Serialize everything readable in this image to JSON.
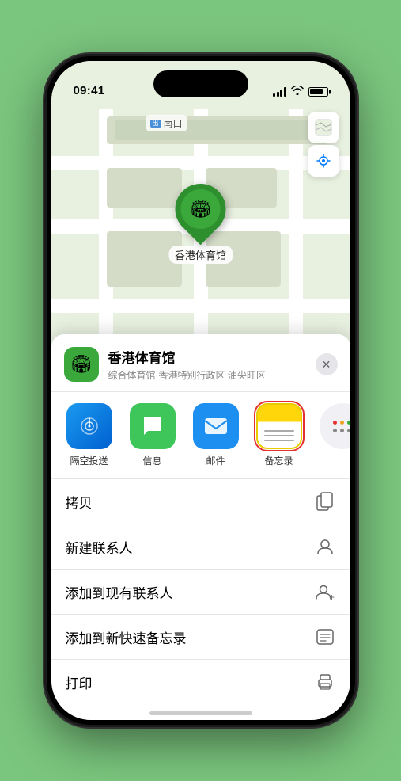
{
  "status_bar": {
    "time": "09:41",
    "location_arrow": "➤"
  },
  "map": {
    "label_icon": "出",
    "label_text": "南口",
    "venue_label": "香港体育馆",
    "pin_emoji": "🏟"
  },
  "map_controls": {
    "map_icon": "🗺",
    "location_icon": "➤"
  },
  "sheet": {
    "venue_emoji": "🏟",
    "venue_name": "香港体育馆",
    "venue_subtitle": "综合体育馆·香港特别行政区 油尖旺区",
    "close_label": "✕"
  },
  "share_apps": [
    {
      "id": "airdrop",
      "label": "隔空投送",
      "emoji": "📡"
    },
    {
      "id": "messages",
      "label": "信息",
      "emoji": "💬"
    },
    {
      "id": "mail",
      "label": "邮件",
      "emoji": "✉"
    },
    {
      "id": "notes",
      "label": "备忘录",
      "emoji": ""
    }
  ],
  "action_items": [
    {
      "id": "copy",
      "label": "拷贝",
      "icon": "📋"
    },
    {
      "id": "new-contact",
      "label": "新建联系人",
      "icon": "👤"
    },
    {
      "id": "add-existing",
      "label": "添加到现有联系人",
      "icon": "➕👤"
    },
    {
      "id": "add-quicknote",
      "label": "添加到新快速备忘录",
      "icon": "📝"
    },
    {
      "id": "print",
      "label": "打印",
      "icon": "🖨"
    }
  ],
  "colors": {
    "green_accent": "#3aa83a",
    "red_highlight": "#e53030",
    "map_bg": "#e8f0e0",
    "sheet_bg": "#ffffff"
  }
}
